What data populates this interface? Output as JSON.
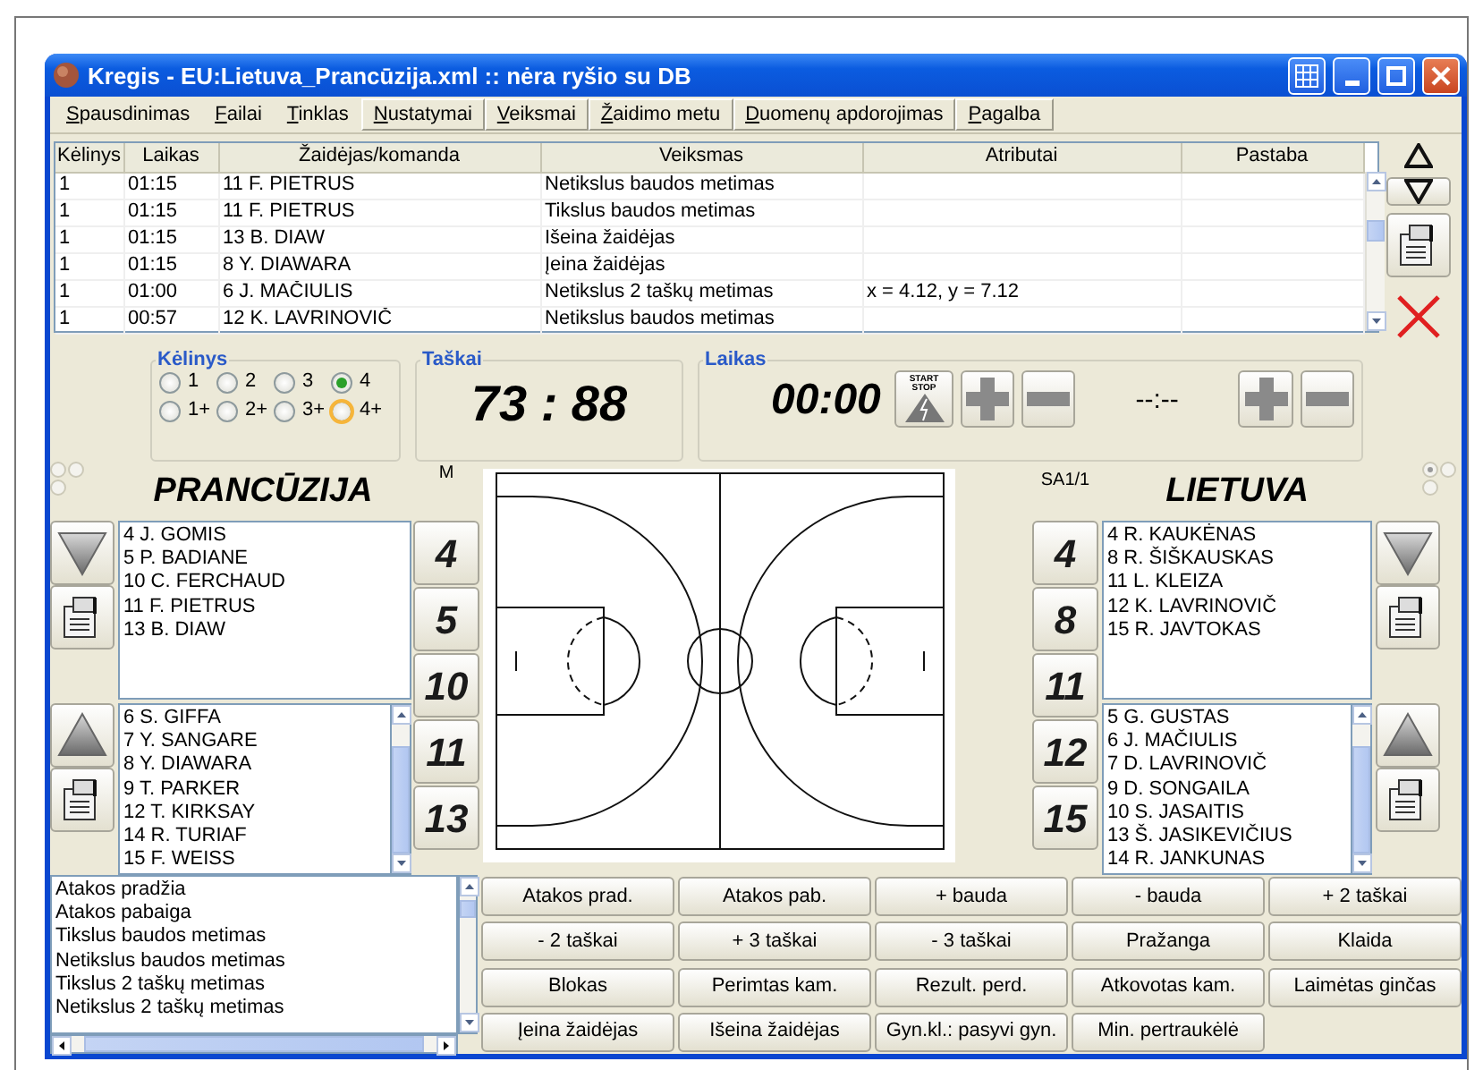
{
  "window": {
    "title": "Kregis - EU:Lietuva_Prancūzija.xml  ::  nėra ryšio su DB"
  },
  "menu": [
    {
      "label": "Spausdinimas",
      "kind": "plain"
    },
    {
      "label": "Failai",
      "kind": "plain"
    },
    {
      "label": "Tinklas",
      "kind": "plain"
    },
    {
      "label": "Nustatymai",
      "kind": "framed"
    },
    {
      "label": "Veiksmai",
      "kind": "framed"
    },
    {
      "label": "Žaidimo metu",
      "kind": "framed"
    },
    {
      "label": "Duomenų apdorojimas",
      "kind": "framed"
    },
    {
      "label": "Pagalba",
      "kind": "framed"
    }
  ],
  "log": {
    "columns": [
      "Kėlinys",
      "Laikas",
      "Žaidėjas/komanda",
      "Veiksmas",
      "Atributai",
      "Pastaba"
    ],
    "rows": [
      {
        "period": "1",
        "time": "01:15",
        "player": "11 F. PIETRUS",
        "action": "Netikslus baudos metimas"
      },
      {
        "period": "1",
        "time": "01:15",
        "player": "11 F. PIETRUS",
        "action": "Tikslus baudos metimas"
      },
      {
        "period": "1",
        "time": "01:15",
        "player": "13 B. DIAW",
        "action": "Išeina žaidėjas"
      },
      {
        "period": "1",
        "time": "01:15",
        "player": "8 Y. DIAWARA",
        "action": "Įeina žaidėjas"
      },
      {
        "period": "1",
        "time": "01:00",
        "player": "6 J. MAČIULIS",
        "action": "Netikslus 2 taškų metimas",
        "attributes": "x = 4.12, y = 7.12"
      },
      {
        "period": "1",
        "time": "00:57",
        "player": "12 K. LAVRINOVIČ",
        "action": "Netikslus baudos metimas"
      }
    ]
  },
  "period": {
    "title": "Kėlinys",
    "options": [
      {
        "label": "1",
        "selected": false,
        "hover": false
      },
      {
        "label": "2",
        "selected": false,
        "hover": false
      },
      {
        "label": "3",
        "selected": false,
        "hover": false
      },
      {
        "label": "4",
        "selected": true,
        "hover": false
      },
      {
        "label": "1+",
        "selected": false,
        "hover": false
      },
      {
        "label": "2+",
        "selected": false,
        "hover": false
      },
      {
        "label": "3+",
        "selected": false,
        "hover": false
      },
      {
        "label": "4+",
        "selected": false,
        "hover": true
      }
    ]
  },
  "score": {
    "title": "Taškai",
    "value": "73 : 88"
  },
  "time": {
    "title": "Laikas",
    "clock": "00:00",
    "start_label": "START",
    "stop_label": "STOP",
    "shot_clock": "--:--"
  },
  "teams": [
    {
      "name": "PRANCŪZIJA",
      "tag": "M",
      "indicators": [
        {
          "selected": false
        },
        {
          "selected": false
        },
        {
          "selected": false
        }
      ],
      "on_court": [
        "4 J. GOMIS",
        "5 P. BADIANE",
        "10 C. FERCHAUD",
        "11 F. PIETRUS",
        "13 B. DIAW"
      ],
      "bench": [
        "6 S. GIFFA",
        "7 Y. SANGARE",
        "8 Y. DIAWARA",
        "9 T. PARKER",
        "12 T. KIRKSAY",
        "14 R. TURIAF",
        "15 F. WEISS"
      ],
      "numbers": [
        "4",
        "5",
        "10",
        "11",
        "13"
      ]
    },
    {
      "name": "LIETUVA",
      "tag": "SA1/1",
      "indicators": [
        {
          "selected": true
        },
        {
          "selected": false
        },
        {
          "selected": false
        }
      ],
      "on_court": [
        "4 R. KAUKĖNAS",
        "8 R. ŠIŠKAUSKAS",
        "11 L. KLEIZA",
        "12 K. LAVRINOVIČ",
        "15 R. JAVTOKAS"
      ],
      "bench": [
        "5 G. GUSTAS",
        "6 J. MAČIULIS",
        "7 D. LAVRINOVIČ",
        "9 D. SONGAILA",
        "10 S. JASAITIS",
        "13 Š. JASIKEVIČIUS",
        "14 R. JANKUNAS"
      ],
      "numbers": [
        "4",
        "8",
        "11",
        "12",
        "15"
      ]
    }
  ],
  "actions": [
    "Atakos pradžia",
    "Atakos pabaiga",
    "Tikslus baudos metimas",
    "Netikslus baudos metimas",
    "Tikslus 2 taškų metimas",
    "Netikslus 2 taškų metimas"
  ],
  "buttons": [
    "Atakos prad.",
    "Atakos pab.",
    "+ bauda",
    "- bauda",
    "+ 2 taškai",
    "- 2 taškai",
    "+ 3 taškai",
    "- 3 taškai",
    "Pražanga",
    "Klaida",
    "Blokas",
    "Perimtas kam.",
    "Rezult. perd.",
    "Atkovotas kam.",
    "Laimėtas ginčas",
    "Įeina žaidėjas",
    "Išeina žaidėjas",
    "Gyn.kl.: pasyvi gyn.",
    "Min. pertraukėlė"
  ]
}
